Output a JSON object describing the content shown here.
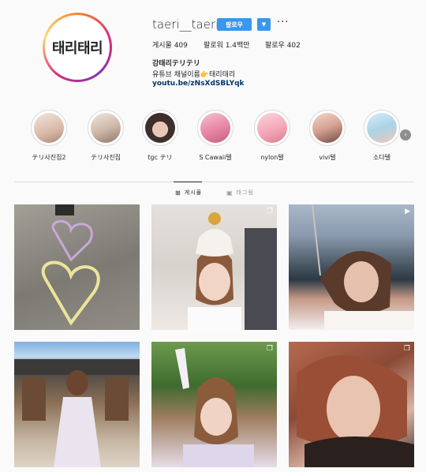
{
  "profile": {
    "logo_text": "태리태리",
    "username": "taeri__taeri",
    "follow_label": "팔로우",
    "dropdown_icon": "chevron-down-icon",
    "more_icon": "more-icon",
    "stats": {
      "posts": "게시물 409",
      "followers": "팔로워 1.4백만",
      "following": "팔로우 402"
    },
    "bio": {
      "name": "강태리テリテリ",
      "line": "유튜브 채널이름👉태리태리",
      "link": "youtu.be/zNsXdSBLYqk"
    }
  },
  "highlights": [
    {
      "label": "テリ사진집2"
    },
    {
      "label": "テリ사진집"
    },
    {
      "label": "tgc テリ"
    },
    {
      "label": "S Cawaii텔"
    },
    {
      "label": "nylon텔"
    },
    {
      "label": "vivi텔"
    },
    {
      "label": "소다텔"
    }
  ],
  "tabs": {
    "posts": "게시물",
    "tagged": "태그됨"
  },
  "colors": {
    "accent": "#3897f0",
    "link": "#003569",
    "divider": "#dbdbdb"
  }
}
